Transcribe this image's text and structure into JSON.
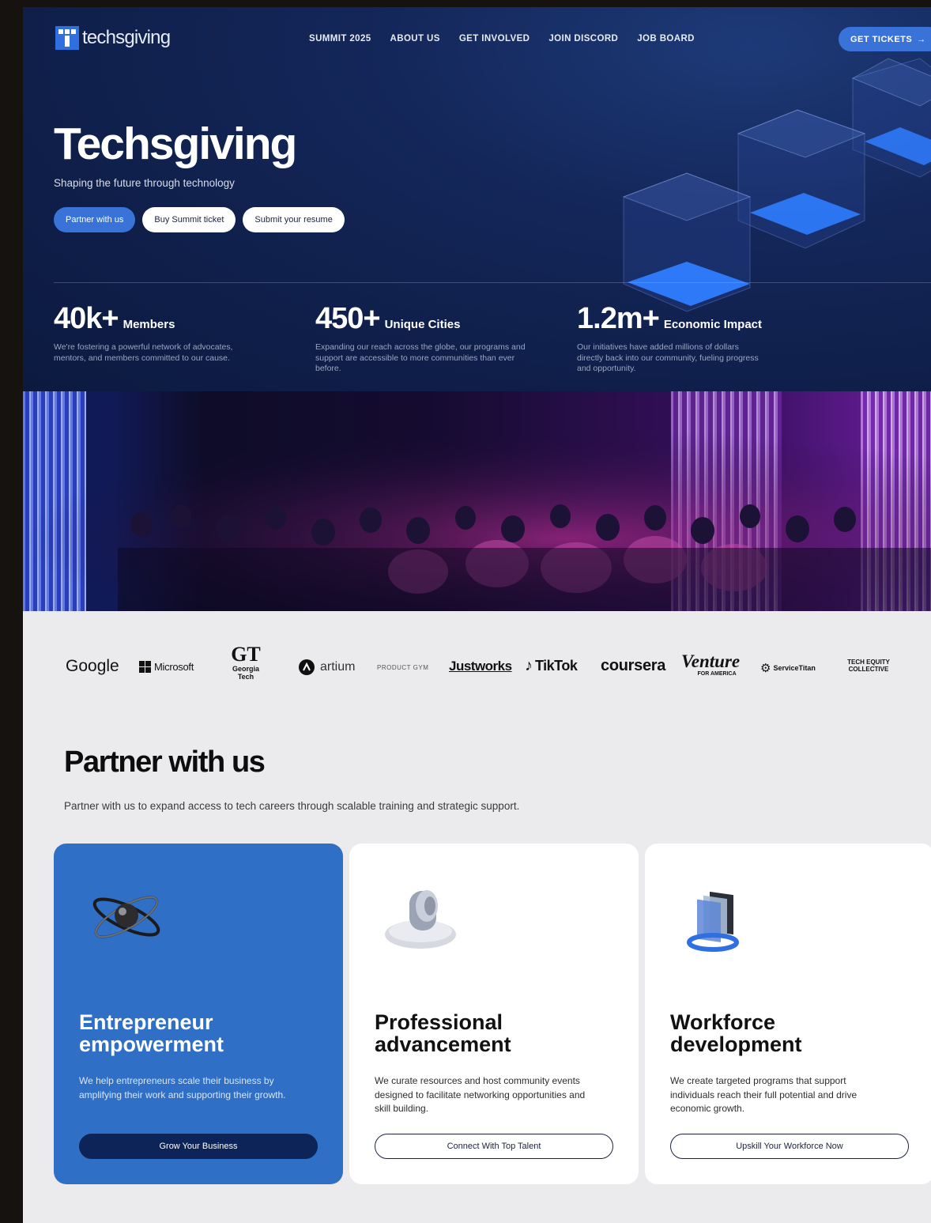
{
  "nav": {
    "logo_text": "techsgiving",
    "links": [
      "SUMMIT 2025",
      "ABOUT US",
      "GET INVOLVED",
      "JOIN DISCORD",
      "JOB BOARD"
    ],
    "cta": "GET TICKETS",
    "cta_arrow": "→"
  },
  "hero": {
    "title": "Techsgiving",
    "subtitle": "Shaping the future through technology",
    "buttons": [
      "Partner with us",
      "Buy Summit ticket",
      "Submit your resume"
    ]
  },
  "stats": [
    {
      "number": "40k+",
      "label": "Members",
      "desc": "We're fostering a powerful network of advocates, mentors, and members committed to our cause."
    },
    {
      "number": "450+",
      "label": "Unique Cities",
      "desc": "Expanding our reach across the globe, our programs and support are accessible to more communities than ever before."
    },
    {
      "number": "1.2m+",
      "label": "Economic Impact",
      "desc": "Our initiatives have added millions of dollars directly back into our community, fueling progress and opportunity."
    }
  ],
  "partners": {
    "google": "Google",
    "microsoft": "Microsoft",
    "georgia_tech_mark": "GT",
    "georgia_tech_name": "Georgia Tech",
    "artium": "artium",
    "product_gym": "PRODUCT GYM",
    "justworks": "Justworks",
    "tiktok": "TikTok",
    "coursera": "coursera",
    "venture": "Venture",
    "venture_sub": "FOR AMERICA",
    "servicetitan": "ServiceTitan",
    "tech_equity": "TECH EQUITY COLLECTIVE"
  },
  "partner_section": {
    "title": "Partner with us",
    "description": "Partner with us to expand access to tech careers through scalable training and strategic support.",
    "cards": [
      {
        "title": "Entrepreneur empowerment",
        "text": "We help entrepreneurs scale their business by amplifying their work and supporting their growth.",
        "button": "Grow Your Business"
      },
      {
        "title": "Professional advancement",
        "text": "We curate resources and host community events designed to facilitate networking opportunities and skill building.",
        "button": "Connect With Top Talent"
      },
      {
        "title": "Workforce development",
        "text": "We create targeted programs that support individuals reach their full potential and drive economic growth.",
        "button": "Upskill Your Workforce Now"
      }
    ]
  },
  "colors": {
    "accent": "#3a73d8",
    "hero_bg": "#14275a",
    "card_blue": "#2f6fc6"
  }
}
